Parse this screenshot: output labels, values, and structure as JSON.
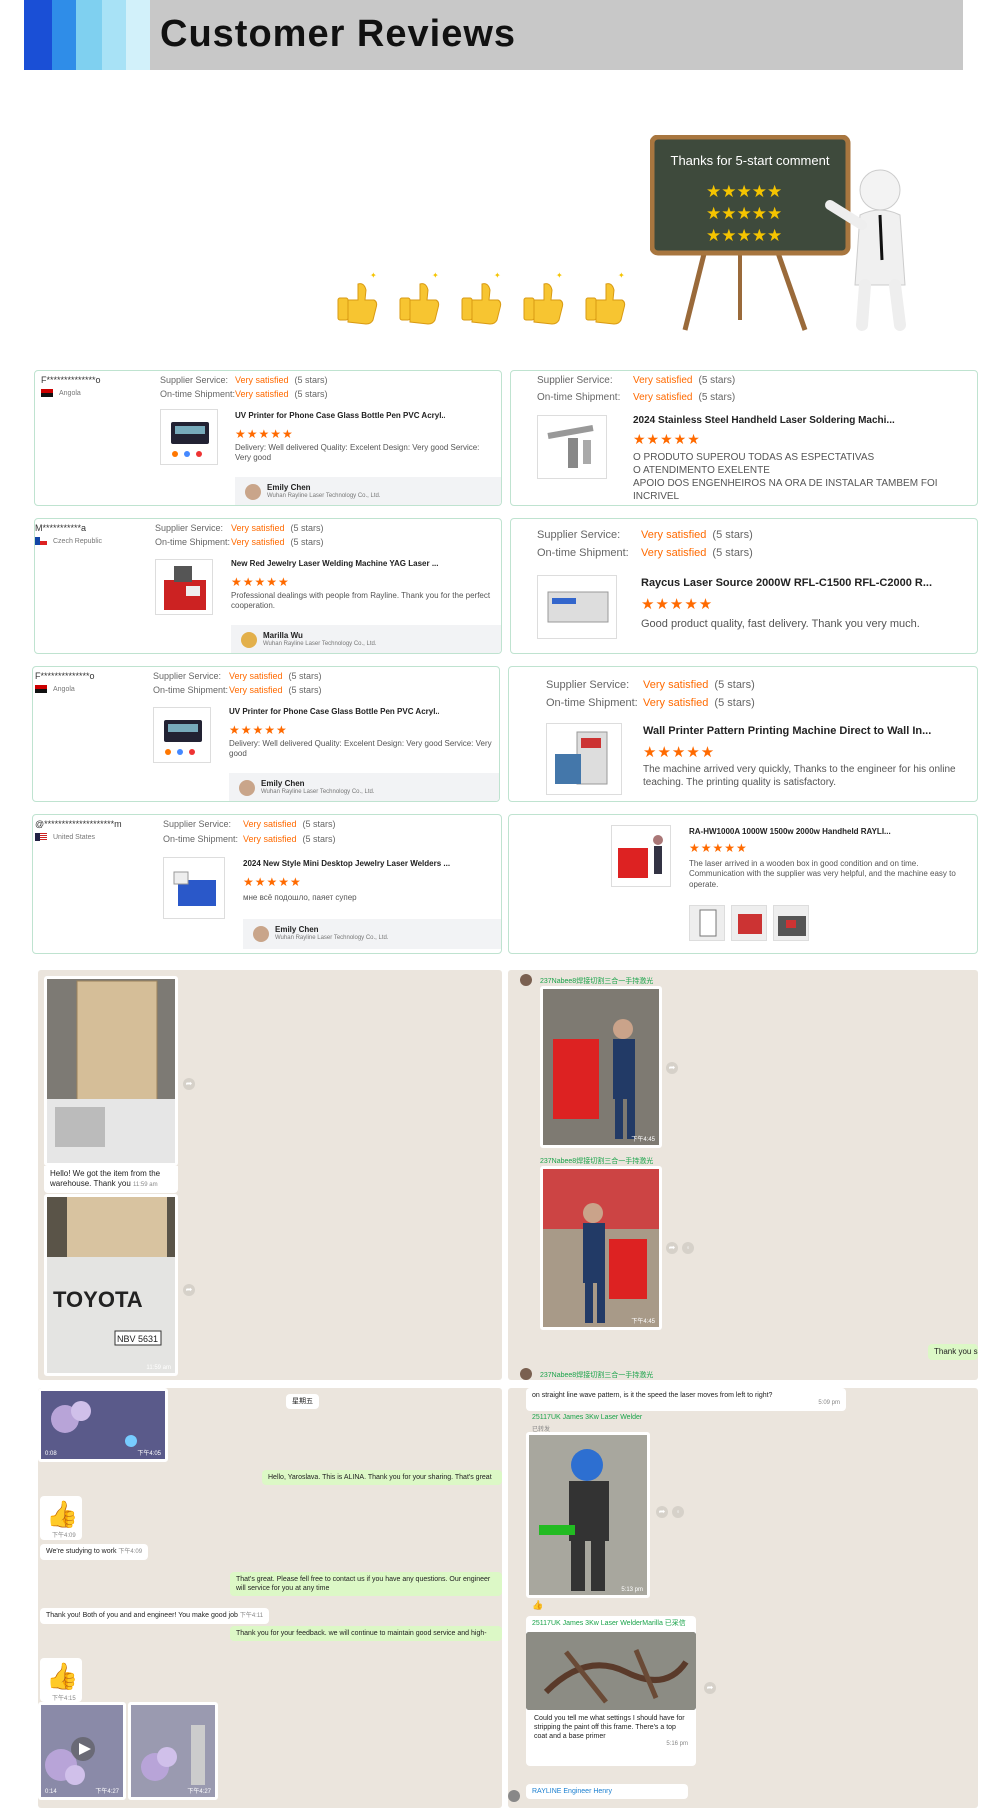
{
  "header": {
    "title": "Customer Reviews",
    "stripe_colors": [
      "#1a4fd6",
      "#2f8de8",
      "#7fd0f0",
      "#a8e2f6",
      "#d2f1fa"
    ]
  },
  "banner": {
    "board_text": "Thanks for 5-start comment",
    "thumb_count": 5,
    "star_rows": 3
  },
  "labels": {
    "service": "Supplier Service:",
    "shipment": "On-time Shipment:",
    "very_satisfied": "Very satisfied",
    "five_stars": "(5 stars)",
    "stars": "★★★★★"
  },
  "reviews": [
    {
      "name": "F**************o",
      "country": "Angola",
      "product": "UV Printer for Phone Case Glass Bottle Pen PVC Acryl...",
      "comment": "Delivery:  Well delivered Quality:  Excelent Design:  Very good Service:  Very good",
      "seller": "Emily Chen",
      "company": "Wuhan Rayline Laser Technology Co., Ltd."
    },
    {
      "product": "2024 Stainless Steel Handheld Laser Soldering Machi...",
      "comment_lines": [
        "O PRODUTO SUPEROU TODAS AS ESPECTATIVAS",
        "O ATENDIMENTO EXELENTE",
        "APOIO DOS ENGENHEIROS NA ORA DE INSTALAR TAMBEM FOI INCRIVEL"
      ]
    },
    {
      "name": "M***********a",
      "country": "Czech Republic",
      "product": "New Red Jewelry Laser Welding Machine YAG Laser ...",
      "comment": "Professional dealings with people from Rayline. Thank you for the perfect cooperation.",
      "seller": "Marilla Wu",
      "company": "Wuhan Rayline Laser Technology Co., Ltd."
    },
    {
      "product": "Raycus Laser Source 2000W RFL-C1500 RFL-C2000 R...",
      "comment": "Good product quality, fast delivery. Thank you very much."
    },
    {
      "name": "F**************o",
      "country": "Angola",
      "product": "UV Printer for Phone Case Glass Bottle Pen PVC Acryl...",
      "comment": "Delivery:  Well delivered Quality:  Excelent Design:  Very good Service:  Very good",
      "seller": "Emily Chen",
      "company": "Wuhan Rayline Laser Technology Co., Ltd."
    },
    {
      "product": "Wall Printer Pattern Printing Machine Direct to Wall In...",
      "comment": "The machine arrived very quickly, Thanks to the engineer for his online teaching. The printing quality is satisfactory."
    },
    {
      "name": "@********************m",
      "country": "United States",
      "product": "2024 New Style Mini Desktop Jewelry Laser Welders ...",
      "comment": "мне всё подошло, паяет супер",
      "seller": "Emily Chen",
      "company": "Wuhan Rayline Laser Technology Co., Ltd."
    },
    {
      "product": "RA-HW1000A 1000W 1500w 2000w Handheld RAYLI...",
      "comment": "The laser arrived in a wooden box in good condition and on time. Communication with the supplier was very helpful, and the machine easy to operate."
    }
  ],
  "chat1": {
    "msg": "Hello! We got the item from the warehouse. Thank you",
    "time1": "11:59 am",
    "time2": "11:59 am",
    "plate": "NBV 5631",
    "truck": "TOYOTA"
  },
  "chat2": {
    "sender": "237Nabee8焊接切割三合一手持激光",
    "time": "下午4:45",
    "reply": "Thank you so",
    "ts2": "下午4:45"
  },
  "chat3": {
    "day": "星期五",
    "video_len": "0:08",
    "t0": "下午4:05",
    "m1": "Hello, Yaroslava. This is ALINA. Thank you for your sharing. That's great",
    "t_thumb": "下午4:09",
    "m2": "We're studying to work",
    "t2": "下午4:09",
    "m3": "That's great. Please fell free to contact us if you have any questions. Our engineer will service for you at any time",
    "m4": "Thank you! Both of you and and engineer! You make good job",
    "t4": "下午4:11",
    "m5": "Thank you for your feedback. we will continue to maintain good service and high-",
    "t_thumb2": "下午4:15",
    "v1": "0:14",
    "t6": "下午4:27",
    "t7": "下午4:27"
  },
  "chat4": {
    "top": "on straight line wave pattern, is it the speed the laser moves from left to right?",
    "top_t": "5:09 pm",
    "sender1": "25117UK James 3Kw Laser Welder",
    "sender_sub": "已转发",
    "t1": "5:13 pm",
    "sender2": "25117UK James 3Kw Laser WelderMarilla 已采信",
    "m2": "Could you tell me what settings I should have for stripping the paint off this frame. There's a top coat and a base primer",
    "t2": "5:16 pm",
    "footer": "RAYLINE Engineer Henry"
  }
}
